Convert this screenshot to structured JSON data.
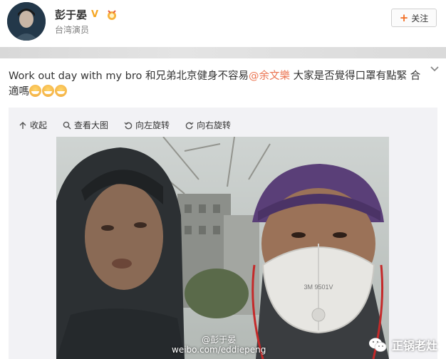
{
  "header": {
    "username": "彭于晏",
    "subtitle": "台湾演员",
    "verified_icon": "verified-v-icon",
    "follow_label": "关注"
  },
  "post": {
    "text_before": "Work out day with my bro 和兄弟北京健身不容易",
    "mention": "@余文樂",
    "text_after": " 大家是否覺得口罩有點緊 合適嗎"
  },
  "toolbar": {
    "collapse": "收起",
    "view_large": "查看大图",
    "rotate_left": "向左旋转",
    "rotate_right": "向右旋转"
  },
  "photo": {
    "credit_line1": "@彭于晏",
    "credit_line2": "weibo.com/eddiepeng",
    "mask_text": "3M 9501V"
  },
  "watermark": {
    "text": "正锅老灶"
  },
  "colors": {
    "mention": "#eb7350",
    "follow_plus": "#f26d22",
    "verified": "#f5a623"
  }
}
